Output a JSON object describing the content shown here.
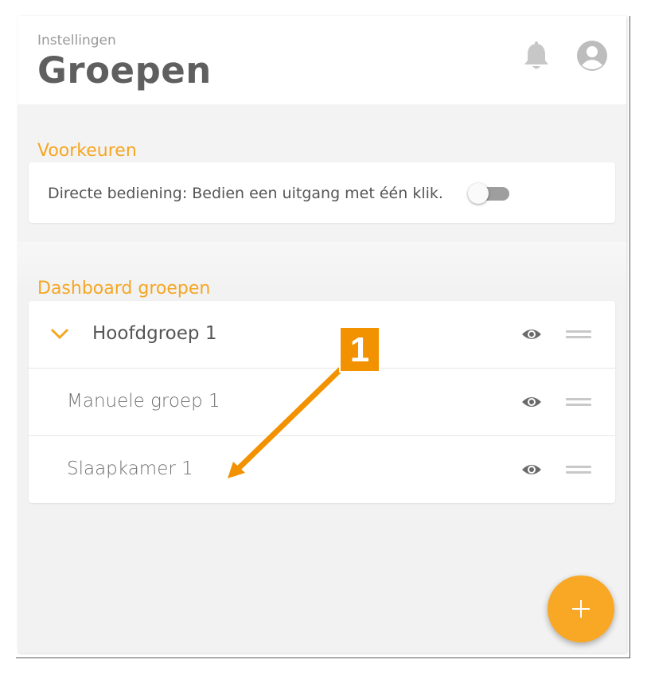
{
  "header": {
    "breadcrumb": "Instellingen",
    "title": "Groepen",
    "icons": {
      "notifications": "bell-icon",
      "account": "account-circle-icon"
    }
  },
  "preferences": {
    "title": "Voorkeuren",
    "direct_control_label": "Directe bediening: Bedien een uitgang met één klik.",
    "direct_control_enabled": false
  },
  "dashboard_groups": {
    "title": "Dashboard groepen",
    "items": [
      {
        "label": "Hoofdgroep 1",
        "expandable": true,
        "expanded": true,
        "visible": true
      },
      {
        "label": "Manuele groep 1",
        "expandable": false,
        "visible": true
      },
      {
        "label": "Slaapkamer 1",
        "expandable": false,
        "visible": true
      }
    ]
  },
  "fab": {
    "icon": "plus-icon"
  },
  "callout": {
    "number": "1"
  },
  "colors": {
    "accent": "#f5a623",
    "fab": "#f9a825",
    "callout": "#f39200",
    "text_dark": "#5f5f5f",
    "icon_gray": "#6a6a6a",
    "toggle_off": "#9e9e9e"
  }
}
